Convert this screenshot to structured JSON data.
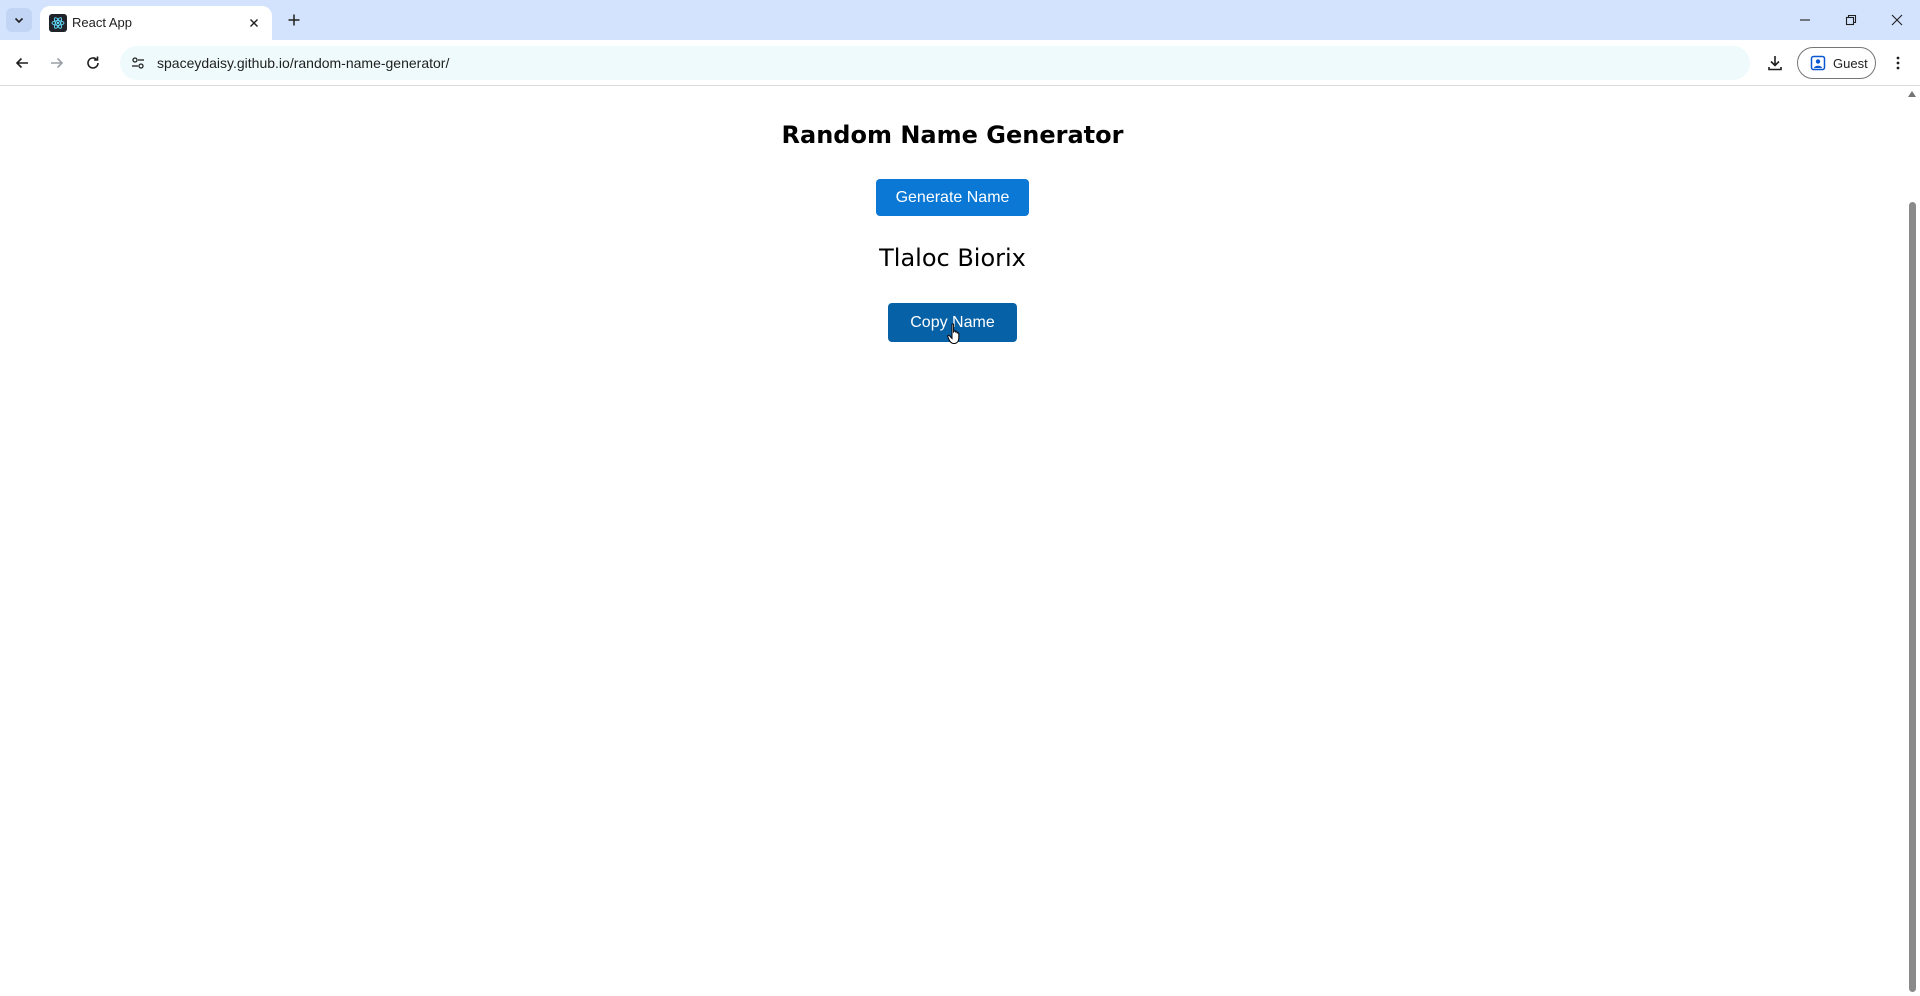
{
  "browser": {
    "tab": {
      "title": "React App",
      "favicon": "react-favicon-icon"
    },
    "url": "spaceydaisy.github.io/random-name-generator/",
    "profile_label": "Guest",
    "colors": {
      "tabstrip": "#d3e3fd",
      "omnibox": "#effafd"
    }
  },
  "app": {
    "title": "Random Name Generator",
    "generate_label": "Generate Name",
    "generated_name": "Tlaloc Biorix",
    "copy_label": "Copy Name",
    "colors": {
      "generate_button": "#0a78d4",
      "copy_button_hover": "#0761a7"
    }
  }
}
